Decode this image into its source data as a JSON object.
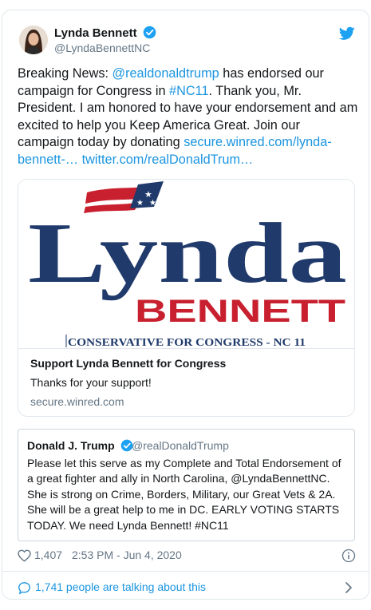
{
  "author": {
    "name": "Lynda Bennett",
    "handle": "@LyndaBennettNC"
  },
  "tweet": {
    "pre": "Breaking News: ",
    "mention": "@realdonaldtrump",
    "mid1": " has endorsed our campaign for Congress in ",
    "hashtag": "#NC11",
    "mid2": ". Thank you, Mr. President. I am honored to have your endorsement and am excited to help you Keep America Great. Join our campaign today by donating ",
    "link1": "secure.winred.com/lynda-bennett-…",
    "link2": "twitter.com/realDonaldTrum…"
  },
  "link_card": {
    "banner": {
      "name_word": "Lynda",
      "surname": "BENNETT",
      "tagline": "CONSERVATIVE FOR CONGRESS - NC 11"
    },
    "title": "Support Lynda Bennett for Congress",
    "description": "Thanks for your support!",
    "domain": "secure.winred.com"
  },
  "quoted_tweet": {
    "name": "Donald J. Trump",
    "handle": "@realDonaldTrump",
    "text": "Please let this serve as my Complete and Total Endorsement of a great fighter and ally in North Carolina, @LyndaBennettNC. She is strong on Crime, Borders, Military, our Great Vets & 2A. She will be a great help to me in DC. EARLY VOTING STARTS TODAY. We need Lynda Bennett! #NC11"
  },
  "footer": {
    "likes": "1,407",
    "timestamp": "2:53 PM - Jun 4, 2020"
  },
  "conversation": {
    "label": "1,741 people are talking about this"
  },
  "colors": {
    "link": "#1b95e0",
    "navy": "#1f3a6b",
    "red": "#c8202f",
    "verified": "#1da1f2"
  },
  "icons": [
    "verified-badge-icon",
    "twitter-bird-icon",
    "heart-icon",
    "info-icon",
    "speech-bubble-icon",
    "chevron-right-icon"
  ]
}
